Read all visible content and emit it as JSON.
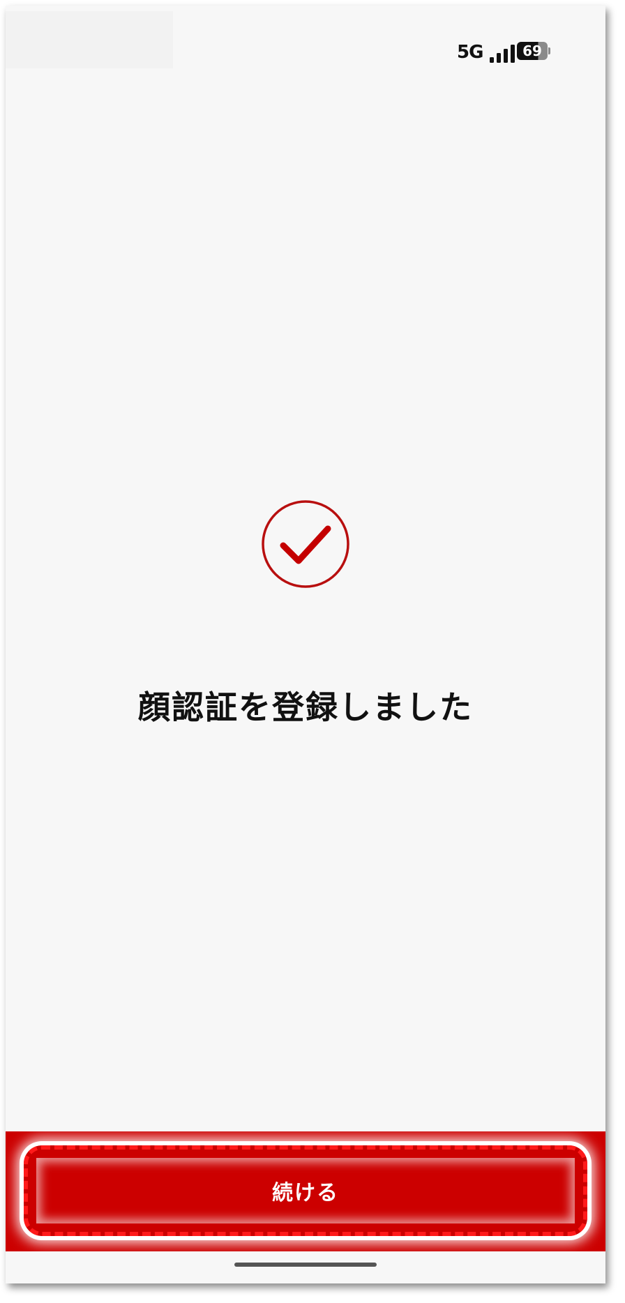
{
  "status_bar": {
    "network": "5G",
    "battery_level": "69",
    "battery_fraction": 0.69,
    "signal_icon": "signal-bars-icon"
  },
  "main": {
    "icon": "check-circle-icon",
    "message": "顔認証を登録しました"
  },
  "footer": {
    "continue_label": "続ける"
  },
  "colors": {
    "brand_red": "#cc0000",
    "background": "#f7f7f7",
    "highlight_dash": "#ff1a1a"
  }
}
